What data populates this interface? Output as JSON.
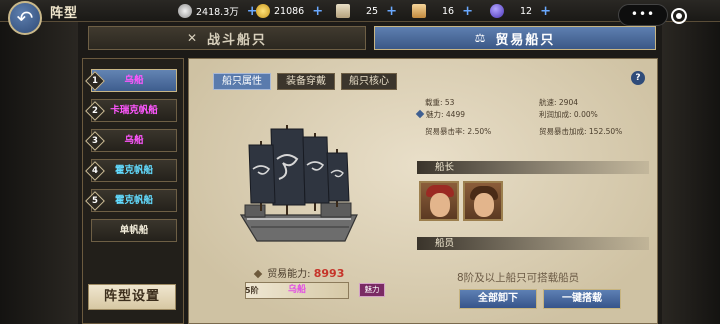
{
  "header": {
    "title": "阵型",
    "resources": [
      {
        "icon": "silver-coin-icon",
        "value": "2418.3万"
      },
      {
        "icon": "gold-coin-icon",
        "value": "21086"
      },
      {
        "icon": "scroll-icon",
        "value": "25"
      },
      {
        "icon": "map-scroll-icon",
        "value": "16"
      },
      {
        "icon": "gem-icon",
        "value": "12"
      }
    ],
    "menu_label": "•••"
  },
  "tabs": [
    {
      "label": "战斗船只",
      "icon": "crossed-swords-icon"
    },
    {
      "label": "贸易船只",
      "icon": "balance-scale-icon"
    }
  ],
  "sidebar": {
    "items": [
      {
        "index": "1",
        "label": "乌船"
      },
      {
        "index": "2",
        "label": "卡瑞克帆船"
      },
      {
        "index": "3",
        "label": "乌船"
      },
      {
        "index": "4",
        "label": "霍克帆船"
      },
      {
        "index": "5",
        "label": "霍克帆船"
      },
      {
        "index": "",
        "label": "单帆船"
      }
    ],
    "formation_button": "阵型设置"
  },
  "subtabs": [
    "船只属性",
    "装备穿戴",
    "船只核心"
  ],
  "stats": {
    "capacity": "载重: 53",
    "speed": "航速: 2904",
    "charm": "魅力: 4499",
    "profit_bonus": "利润加成: 0.00%",
    "crit_rate": "贸易暴击率: 2.50%",
    "crit_bonus": "贸易暴击加成: 152.50%"
  },
  "captain_label": "船长",
  "crew_label": "船员",
  "crew_notice": "8阶及以上船只可搭载船员",
  "buttons": {
    "unload_all": "全部卸下",
    "one_click": "一键搭载"
  },
  "ship": {
    "ability_label": "贸易能力:",
    "ability_value": "8993",
    "tier": "5阶",
    "name": "乌船",
    "tag": "魅力"
  },
  "colors": {
    "accent_blue": "#5a7bad",
    "ability_red": "#c6342a",
    "ship_name_magenta": "#e250e2"
  }
}
